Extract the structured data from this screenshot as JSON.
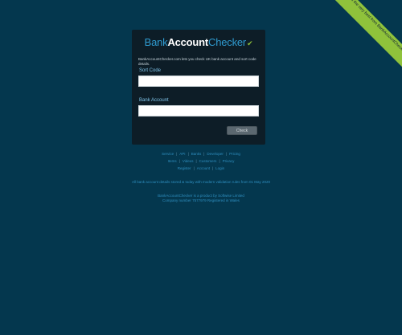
{
  "ribbon": {
    "text": "Happy 2020. All the very best from BankAccountChecker.com"
  },
  "logo": {
    "part1": "Bank",
    "part2": "Account",
    "part3": "Checker",
    "tick": "✔"
  },
  "intro": "BankAccountChecker.com lets you check UK bank account and sort code details.",
  "form": {
    "sort_code_label": "Sort Code",
    "sort_code_value": "",
    "account_label": "Bank Account",
    "account_value": "",
    "check_label": "Check"
  },
  "links_row1": [
    "Service",
    "API",
    "Banks",
    "Developer",
    "Pricing"
  ],
  "links_row2": [
    "Items",
    "Videos",
    "Customers",
    "Privacy"
  ],
  "links_row3": [
    "Register",
    "Account",
    "Login"
  ],
  "notice": "All bank account details stored & today with modern validation rules from 01 May 2020",
  "footer": {
    "line1": "BankAccountChecker is a product by Softwise Limited",
    "line2": "Company number 7577979 Registered in Wales"
  },
  "colors": {
    "background": "#04374e",
    "panel": "#0d1d27",
    "accent": "#2f9bd0",
    "ribbon": "#8fc23b"
  }
}
